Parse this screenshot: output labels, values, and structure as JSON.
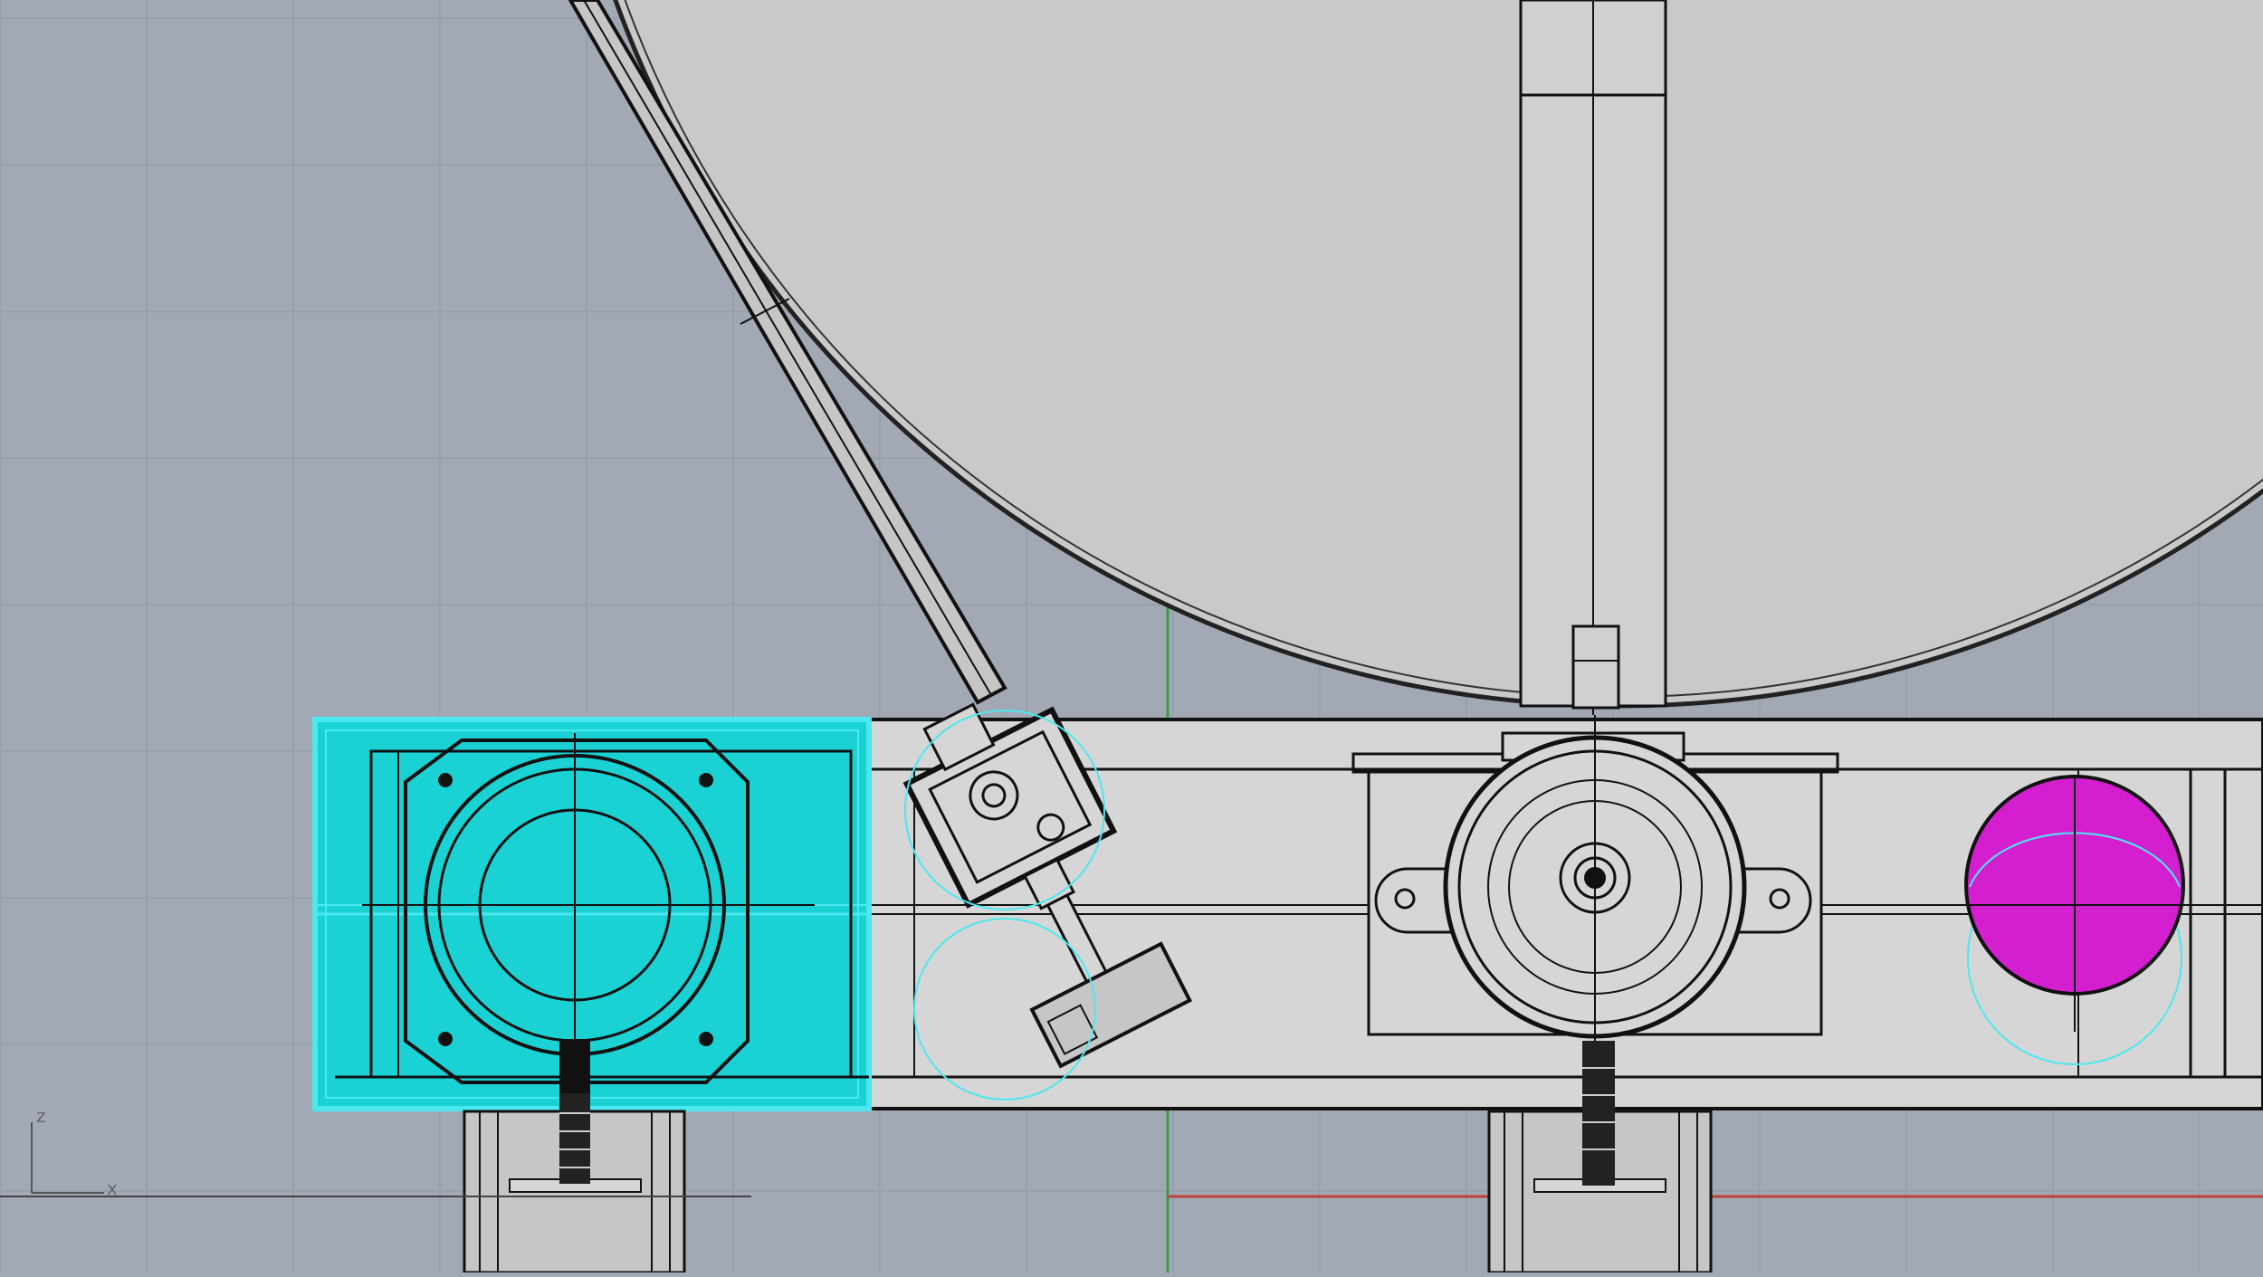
{
  "viewport": {
    "view": "Front",
    "background_color": "#a2a9b4",
    "grid_color": "#98a0ab",
    "major_grid_color": "#8f97a2",
    "x_axis_color": "#c0403a",
    "z_axis_color": "#3e9a45"
  },
  "axis_widget": {
    "z_label": "z",
    "x_label": "x"
  },
  "objects": {
    "spool": {
      "fill": "#c9c9c9"
    },
    "selected_motor_block": {
      "fill": "#1ad2d4",
      "highlight": "#4be8f0"
    },
    "selected_sphere": {
      "fill": "#d41fd0"
    },
    "frame": {
      "fill": "#d6d6d6"
    },
    "feet": {
      "fill": "#c6c6c6"
    }
  }
}
